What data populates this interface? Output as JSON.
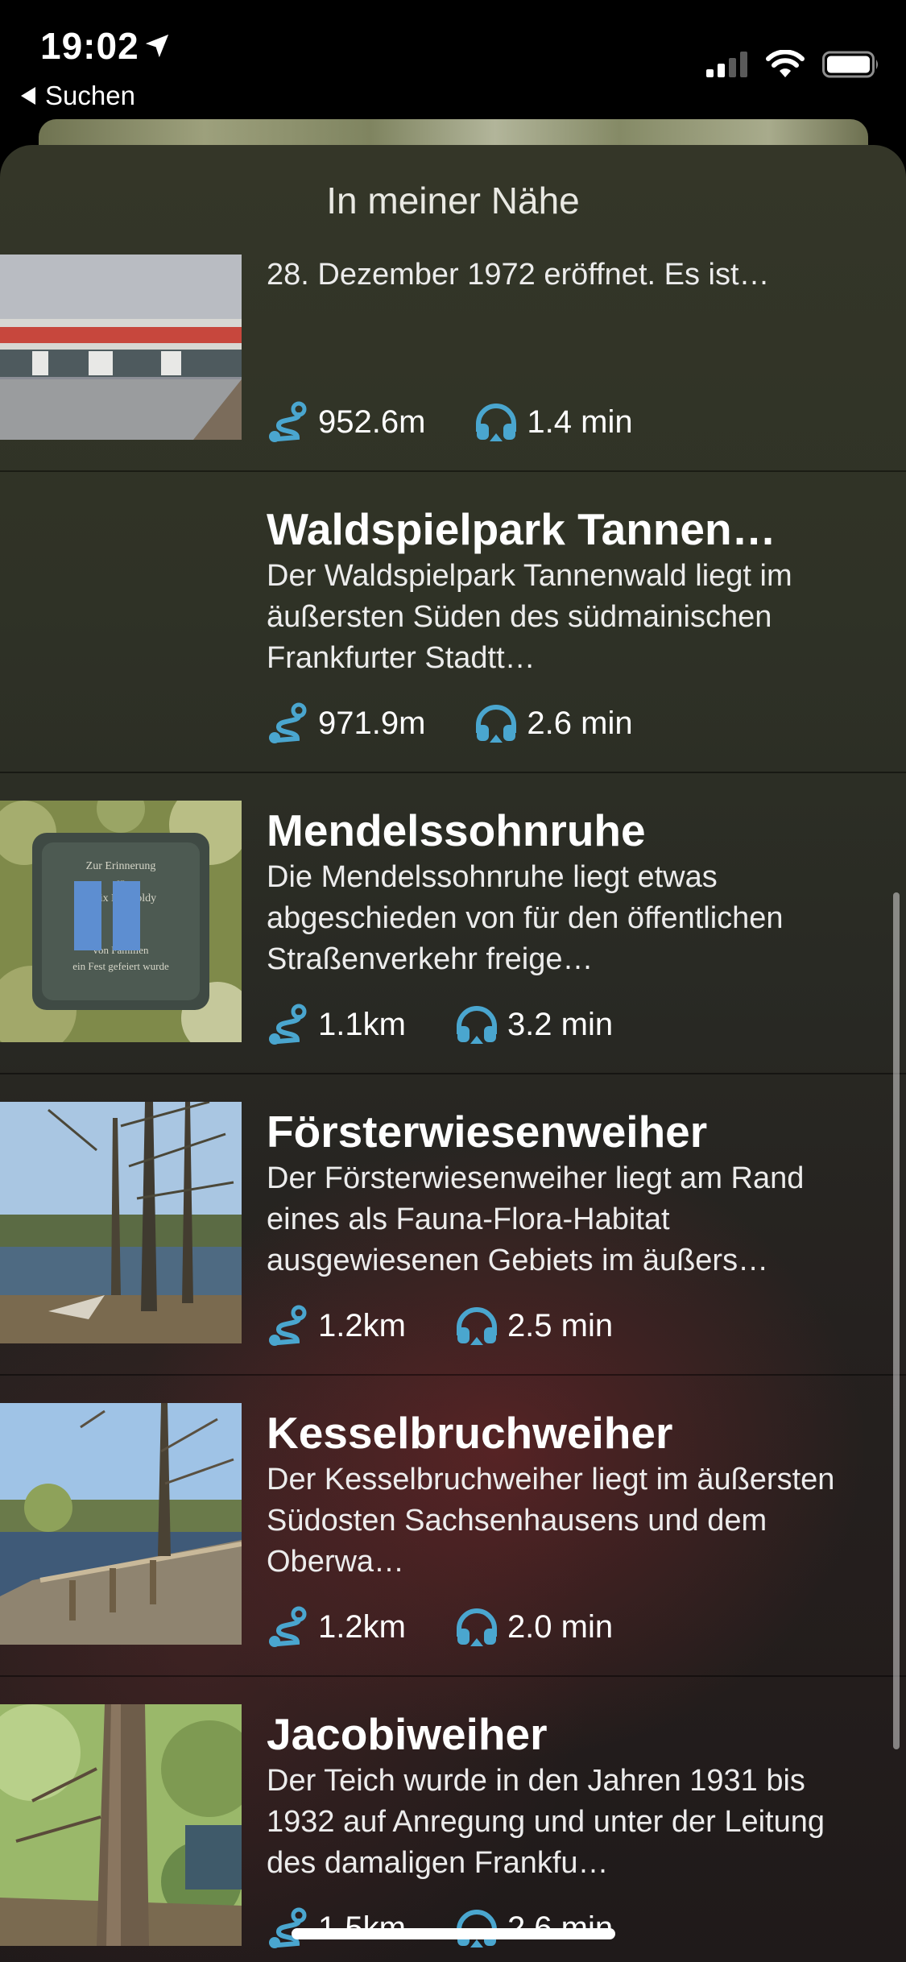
{
  "status": {
    "time": "19:02",
    "back_label": "Suchen"
  },
  "sheet": {
    "title": "In meiner Nähe"
  },
  "first_item": {
    "desc_tail": "28. Dezember 1972 eröffnet. Es ist…",
    "distance": "952.6m",
    "duration": "1.4 min"
  },
  "items": [
    {
      "title": "Waldspielpark Tannen…",
      "desc": "Der Waldspielpark Tannenwald liegt im äußersten Süden des südmainischen Frankfurter Stadtt…",
      "distance": "971.9m",
      "duration": "2.6 min"
    },
    {
      "title": "Mendelssohnruhe",
      "desc": "Die Mendelssohnruhe liegt etwas abgeschieden von für den öffentlichen Straßenverkehr freige…",
      "distance": "1.1km",
      "duration": "3.2 min"
    },
    {
      "title": "Försterwiesenweiher",
      "desc": "Der Försterwiesenweiher liegt am Rand eines als Fauna-Flora-Habitat ausgewiesenen Gebiets im äußers…",
      "distance": "1.2km",
      "duration": "2.5 min"
    },
    {
      "title": "Kesselbruchweiher",
      "desc": "Der Kesselbruchweiher liegt im äußersten Südosten Sachsenhausens und dem Oberwa…",
      "distance": "1.2km",
      "duration": "2.0 min"
    },
    {
      "title": "Jacobiweiher",
      "desc": "Der Teich wurde in den Jahren 1931 bis 1932 auf Anregung und unter der Leitung des damaligen Frankfu…",
      "distance": "1.5km",
      "duration": "2.6 min"
    }
  ],
  "colors": {
    "accent": "#4aa6cf"
  }
}
